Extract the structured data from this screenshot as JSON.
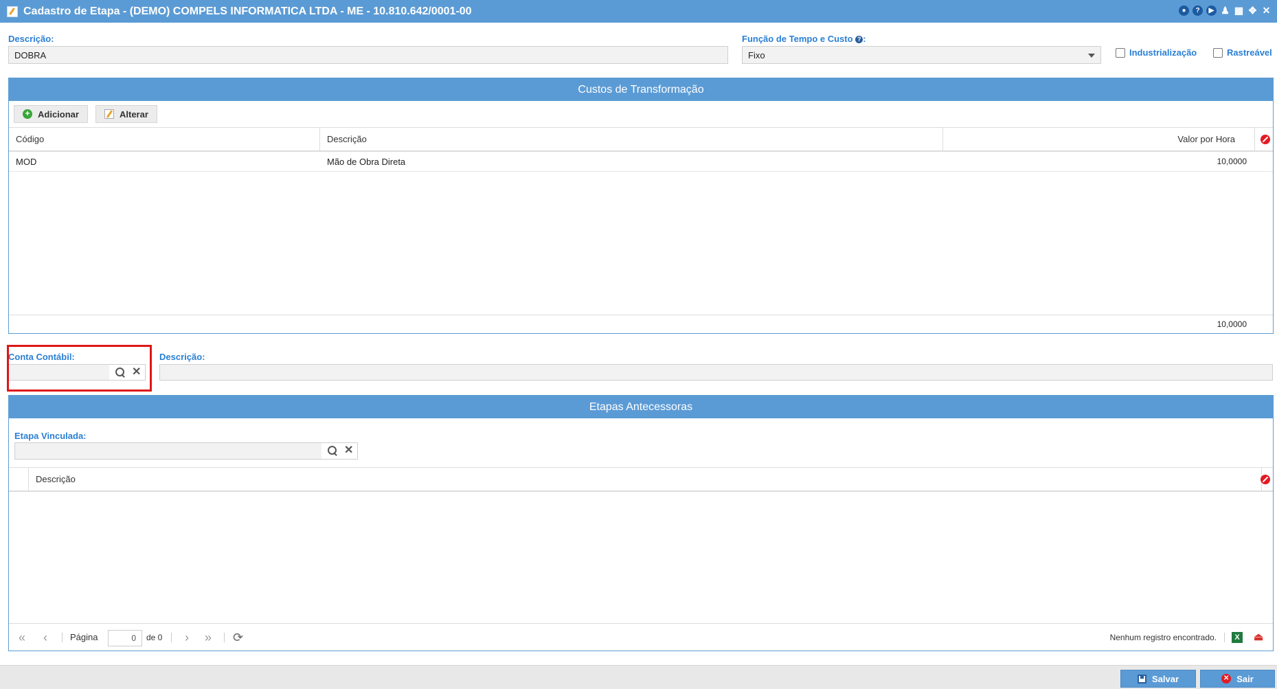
{
  "window": {
    "title": "Cadastro de Etapa - (DEMO) COMPELS INFORMATICA LTDA - ME - 10.810.642/0001-00",
    "controls": [
      "circle-icon",
      "help-icon",
      "play-icon",
      "user-icon",
      "calendar-icon",
      "shrink-icon",
      "close-icon"
    ]
  },
  "form": {
    "descricao_label": "Descrição:",
    "descricao_value": "DOBRA",
    "funcao_label": "Função de Tempo e Custo",
    "funcao_colon": ":",
    "funcao_value": "Fixo",
    "industrializacao_label": "Industrialização",
    "rastreavel_label": "Rastreável"
  },
  "custos": {
    "title": "Custos de Transformação",
    "add_label": "Adicionar",
    "edit_label": "Alterar",
    "columns": [
      "Código",
      "Descrição",
      "Valor por Hora"
    ],
    "rows": [
      {
        "codigo": "MOD",
        "descricao": "Mão de Obra Direta",
        "valor": "10,0000"
      }
    ],
    "total": "10,0000"
  },
  "conta": {
    "label": "Conta Contábil:",
    "value": "",
    "descricao_label": "Descrição:",
    "descricao_value": ""
  },
  "etapas": {
    "title": "Etapas Antecessoras",
    "vinculada_label": "Etapa Vinculada:",
    "vinculada_value": "",
    "column_descricao": "Descrição",
    "pager": {
      "page_label": "Página",
      "page_value": "0",
      "of_label": "de 0",
      "status": "Nenhum registro encontrado."
    }
  },
  "actions": {
    "save_label": "Salvar",
    "exit_label": "Sair"
  },
  "colors": {
    "primary": "#5b9bd5",
    "label": "#2a7fd4",
    "highlight": "#e01515"
  }
}
